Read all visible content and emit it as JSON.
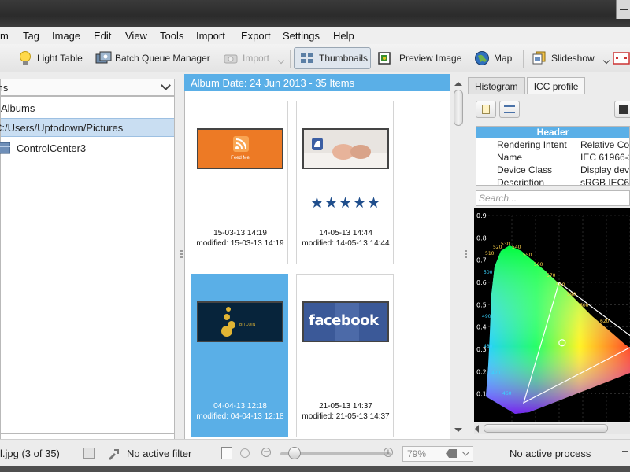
{
  "menu": [
    "m",
    "Tag",
    "Image",
    "Edit",
    "View",
    "Tools",
    "Import",
    "Export",
    "Settings",
    "Help"
  ],
  "toolbar": {
    "light_table": "Light Table",
    "batch_queue": "Batch Queue Manager",
    "import": "Import",
    "thumbnails": "Thumbnails",
    "preview": "Preview Image",
    "map": "Map",
    "slideshow": "Slideshow"
  },
  "left": {
    "combo_label": "ms",
    "tree": [
      "Albums",
      "C:/Users/Uptodown/Pictures",
      "ControlCenter3"
    ]
  },
  "album": {
    "header": "Album Date: 24 Jun 2013 - 35 Items",
    "items": [
      {
        "date": "15-03-13 14:19",
        "modified": "modified: 15-03-13 14:19",
        "thumb_text": "Feed Me"
      },
      {
        "date": "14-05-13 14:44",
        "modified": "modified: 14-05-13 14:44",
        "stars": "★★★★★"
      },
      {
        "date": "04-04-13 12:18",
        "modified": "modified: 04-04-13 12:18",
        "thumb_text": "BITCOIN"
      },
      {
        "date": "21-05-13 14:37",
        "modified": "modified: 21-05-13 14:37",
        "thumb_text": "facebook"
      }
    ]
  },
  "right": {
    "tabs": [
      "Histogram",
      "ICC profile"
    ],
    "props_header": "Header",
    "props": [
      {
        "key": "Rendering Intent",
        "value": "Relative Co"
      },
      {
        "key": "Name",
        "value": "IEC 61966-2"
      },
      {
        "key": "Device Class",
        "value": "Display dev"
      },
      {
        "key": "Description",
        "value": "sRGB IEC61"
      }
    ],
    "search_placeholder": "Search...",
    "chart_data": {
      "type": "scatter",
      "title": "",
      "xlabel": "",
      "ylabel": "",
      "y_ticks": [
        "0.9",
        "0.8",
        "0.7",
        "0.6",
        "0.5",
        "0.4",
        "0.3",
        "0.2",
        "0.1"
      ],
      "xlim": [
        0,
        0.8
      ],
      "ylim": [
        0,
        0.9
      ],
      "wavelength_labels": [
        "520",
        "530",
        "510",
        "540",
        "550",
        "560",
        "570",
        "580",
        "590",
        "600",
        "620",
        "500",
        "490",
        "480",
        "470",
        "460"
      ],
      "gamut_triangle": [
        {
          "x": 0.64,
          "y": 0.33
        },
        {
          "x": 0.3,
          "y": 0.6
        },
        {
          "x": 0.15,
          "y": 0.06
        }
      ],
      "white_point": {
        "x": 0.3127,
        "y": 0.329
      },
      "grid": true
    }
  },
  "status": {
    "filename": "l.jpg (3 of 35)",
    "filter": "No active filter",
    "zoom": "79%",
    "process": "No active process"
  }
}
